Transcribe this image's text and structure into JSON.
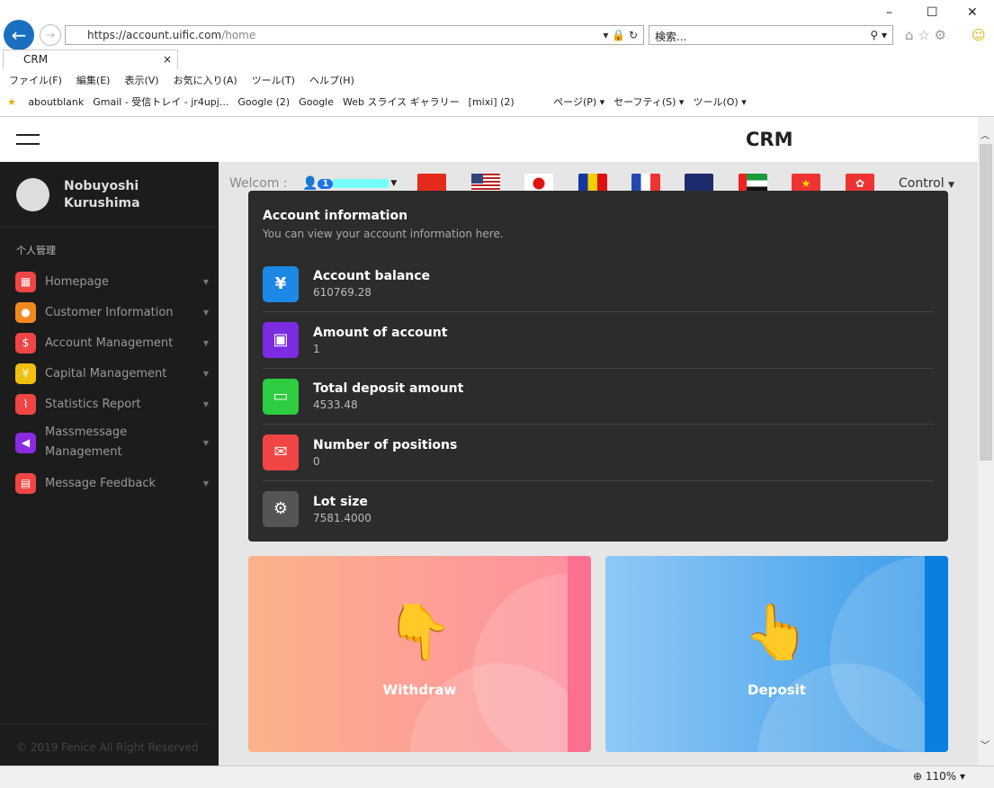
{
  "browser": {
    "url_prefix": "https://",
    "url_host": "account.uific.com",
    "url_path": "/home",
    "search_placeholder": "検索...",
    "tab_title": "CRM",
    "menu": [
      "ファイル(F)",
      "編集(E)",
      "表示(V)",
      "お気に入り(A)",
      "ツール(T)",
      "ヘルプ(H)"
    ],
    "favorites": [
      "aboutblank",
      "Gmail - 受信トレイ - jr4upj...",
      "Google (2)",
      "Google",
      "Web スライス ギャラリー",
      "[mixi] (2)"
    ],
    "commands": [
      "ページ(P) ▾",
      "セーフティ(S) ▾",
      "ツール(O) ▾"
    ],
    "zoom": "110%"
  },
  "header": {
    "title": "CRM"
  },
  "sidebar": {
    "user": "Nobuyoshi Kurushima",
    "section": "个人管理",
    "items": [
      {
        "label": "Homepage",
        "color": "#f04545",
        "icon": "▦"
      },
      {
        "label": "Customer Information",
        "color": "#f08a1e",
        "icon": "●"
      },
      {
        "label": "Account Management",
        "color": "#f04545",
        "icon": "$"
      },
      {
        "label": "Capital Management",
        "color": "#f0c010",
        "icon": "¥"
      },
      {
        "label": "Statistics Report",
        "color": "#f04545",
        "icon": "⌇"
      },
      {
        "label": "Massmessage Management",
        "color": "#8a2be2",
        "icon": "◀"
      },
      {
        "label": "Message Feedback",
        "color": "#f04545",
        "icon": "▤"
      }
    ],
    "copyright": "© 2019 Fenice All Right Reserved"
  },
  "topbar": {
    "welcome": "Welcom :",
    "badge": "1",
    "control": "Control"
  },
  "account": {
    "title": "Account information",
    "subtitle": "You can view your account information here.",
    "rows": [
      {
        "label": "Account balance",
        "value": "610769.28",
        "color": "#1e88e5",
        "icon": "¥"
      },
      {
        "label": "Amount of account",
        "value": "1",
        "color": "#7b2be2",
        "icon": "▣"
      },
      {
        "label": "Total deposit amount",
        "value": "4533.48",
        "color": "#2ecc40",
        "icon": "▭"
      },
      {
        "label": "Number of positions",
        "value": "0",
        "color": "#f04545",
        "icon": "✉"
      },
      {
        "label": "Lot size",
        "value": "7581.4000",
        "color": "#555555",
        "icon": "⚙"
      }
    ]
  },
  "actions": {
    "withdraw": "Withdraw",
    "deposit": "Deposit"
  }
}
